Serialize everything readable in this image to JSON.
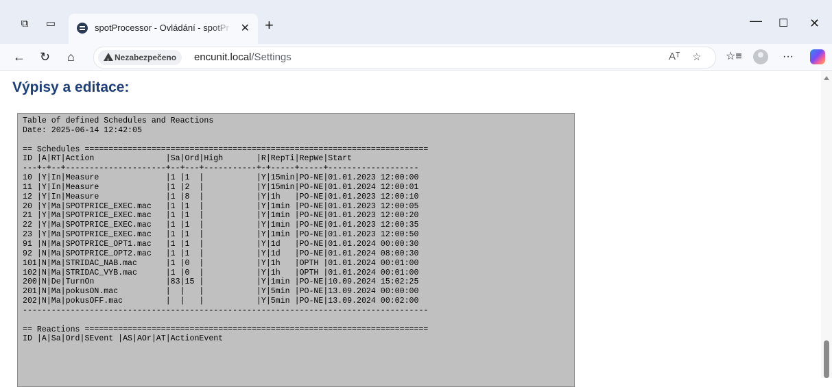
{
  "browser": {
    "tab_title": "spotProcessor - Ovládání - spotPr",
    "new_tab_label": "+",
    "close_tab_label": "✕",
    "security_label": "Nezabezpečeno",
    "url_host": "encunit.local",
    "url_path": "/Settings",
    "more_label": "···",
    "read_aloud_label": "Aᵀ"
  },
  "page": {
    "heading": "Výpisy a editace:",
    "listing": "Table of defined Schedules and Reactions\nDate: 2025-06-14 12:42:05\n\n== Schedules ========================================================================\nID |A|RT|Action               |Sa|Ord|High       |R|RepTi|RepWe|Start\n---+-+--+---------------------+--+---+-----------+-+-----+-----+-------------------\n10 |Y|In|Measure              |1 |1  |           |Y|15min|PO-NE|01.01.2023 12:00:00\n11 |Y|In|Measure              |1 |2  |           |Y|15min|PO-NE|01.01.2024 12:00:01\n12 |Y|In|Measure              |1 |8  |           |Y|1h   |PO-NE|01.01.2023 12:00:10\n20 |Y|Ma|SPOTPRICE_EXEC.mac   |1 |1  |           |Y|1min |PO-NE|01.01.2023 12:00:05\n21 |Y|Ma|SPOTPRICE_EXEC.mac   |1 |1  |           |Y|1min |PO-NE|01.01.2023 12:00:20\n22 |Y|Ma|SPOTPRICE_EXEC.mac   |1 |1  |           |Y|1min |PO-NE|01.01.2023 12:00:35\n23 |Y|Ma|SPOTPRICE_EXEC.mac   |1 |1  |           |Y|1min |PO-NE|01.01.2023 12:00:50\n91 |N|Ma|SPOTPRICE_OPT1.mac   |1 |1  |           |Y|1d   |PO-NE|01.01.2024 00:00:30\n92 |N|Ma|SPOTPRICE_OPT2.mac   |1 |1  |           |Y|1d   |PO-NE|01.01.2024 08:00:30\n101|N|Ma|STRIDAC_NAB.mac      |1 |0  |           |Y|1h   |OPTH |01.01.2024 00:01:00\n102|N|Ma|STRIDAC_VYB.mac      |1 |0  |           |Y|1h   |OPTH |01.01.2024 00:01:00\n200|N|De|TurnOn               |83|15 |           |Y|1min |PO-NE|10.09.2024 15:02:25\n201|N|Ma|pokusON.mac          |  |   |           |Y|5min |PO-NE|13.09.2024 00:00:00\n202|N|Ma|pokusOFF.mac         |  |   |           |Y|5min |PO-NE|13.09.2024 00:02:00\n-------------------------------------------------------------------------------------\n\n== Reactions ========================================================================\nID |A|Sa|Ord|SEvent |AS|AOr|AT|ActionEvent"
  }
}
